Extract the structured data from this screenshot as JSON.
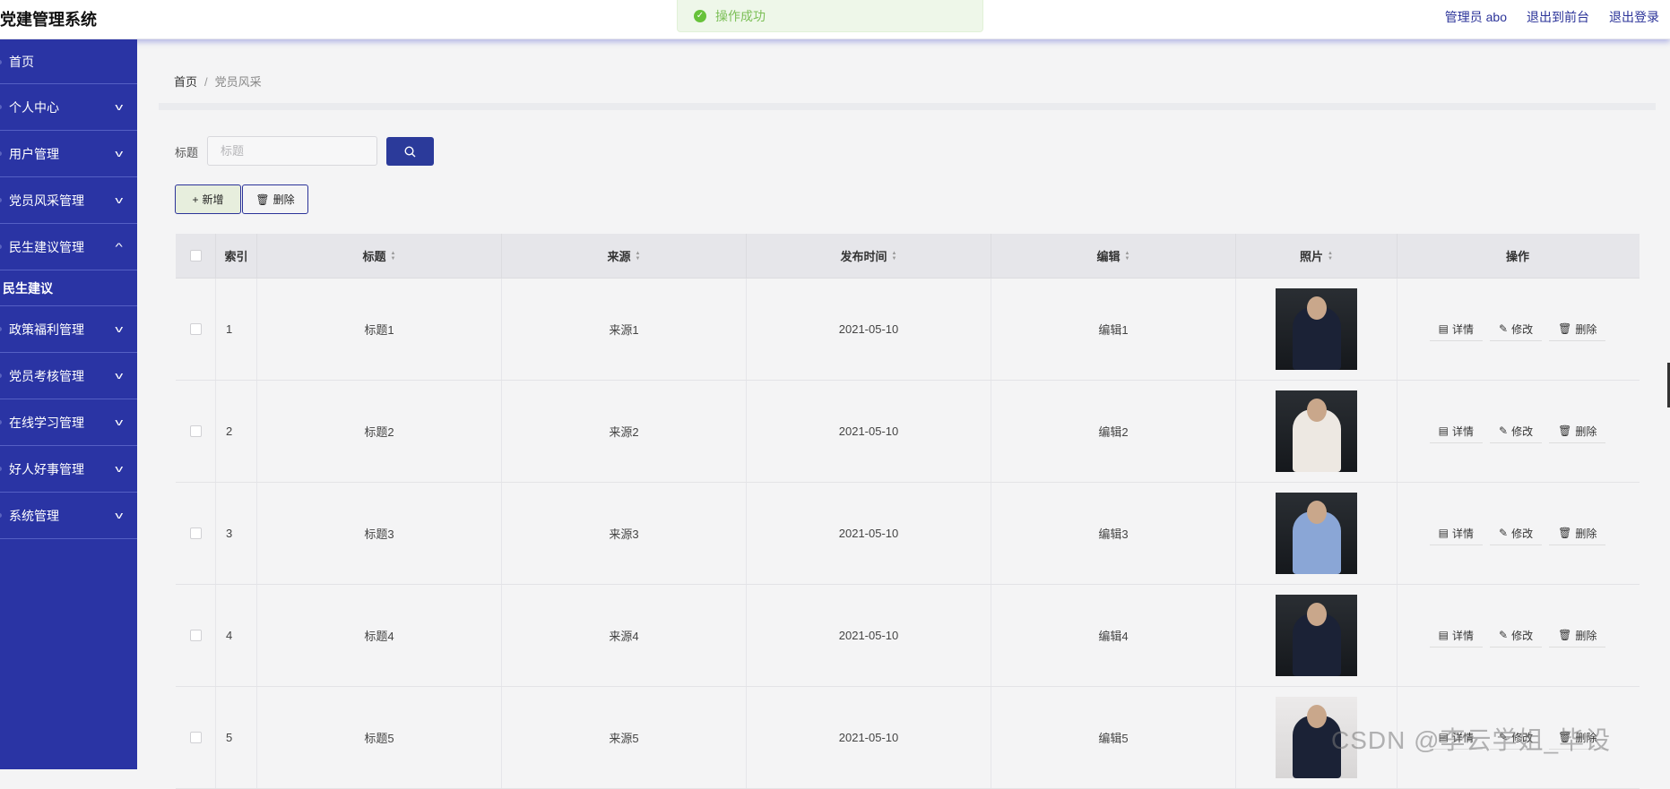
{
  "app": {
    "title": "党建管理系统"
  },
  "toast": {
    "text": "操作成功"
  },
  "header_links": [
    "管理员 abo",
    "退出到前台",
    "退出登录"
  ],
  "sidebar": {
    "items": [
      {
        "label": "首页",
        "chevron": ""
      },
      {
        "label": "个人中心",
        "chevron": "⌄"
      },
      {
        "label": "用户管理",
        "chevron": "⌄"
      },
      {
        "label": "党员风采管理",
        "chevron": "⌄"
      },
      {
        "label": "民生建议管理",
        "chevron": "⌃"
      },
      {
        "label": "政策福利管理",
        "chevron": "⌄"
      },
      {
        "label": "党员考核管理",
        "chevron": "⌄"
      },
      {
        "label": "在线学习管理",
        "chevron": "⌄"
      },
      {
        "label": "好人好事管理",
        "chevron": "⌄"
      },
      {
        "label": "系统管理",
        "chevron": "⌄"
      }
    ],
    "sub_item": "民生建议"
  },
  "breadcrumb": {
    "home": "首页",
    "sep": "/",
    "current": "党员风采"
  },
  "search": {
    "label": "标题",
    "placeholder": "标题"
  },
  "toolbar": {
    "add_label": "新增",
    "delete_label": "删除"
  },
  "table": {
    "headers": [
      "索引",
      "标题",
      "来源",
      "发布时间",
      "编辑",
      "照片",
      "操作"
    ],
    "rows": [
      {
        "index": "1",
        "title": "标题1",
        "source": "来源1",
        "date": "2021-05-10",
        "editor": "编辑1"
      },
      {
        "index": "2",
        "title": "标题2",
        "source": "来源2",
        "date": "2021-05-10",
        "editor": "编辑2"
      },
      {
        "index": "3",
        "title": "标题3",
        "source": "来源3",
        "date": "2021-05-10",
        "editor": "编辑3"
      },
      {
        "index": "4",
        "title": "标题4",
        "source": "来源4",
        "date": "2021-05-10",
        "editor": "编辑4"
      },
      {
        "index": "5",
        "title": "标题5",
        "source": "来源5",
        "date": "2021-05-10",
        "editor": "编辑5"
      }
    ],
    "actions": {
      "detail": "详情",
      "edit": "修改",
      "delete": "删除"
    }
  },
  "watermark": "CSDN @李云学姐_毕设",
  "colors": {
    "sidebar": "#2a34a4",
    "accent": "#2b3a9a",
    "toast_text": "#7cbf57"
  }
}
